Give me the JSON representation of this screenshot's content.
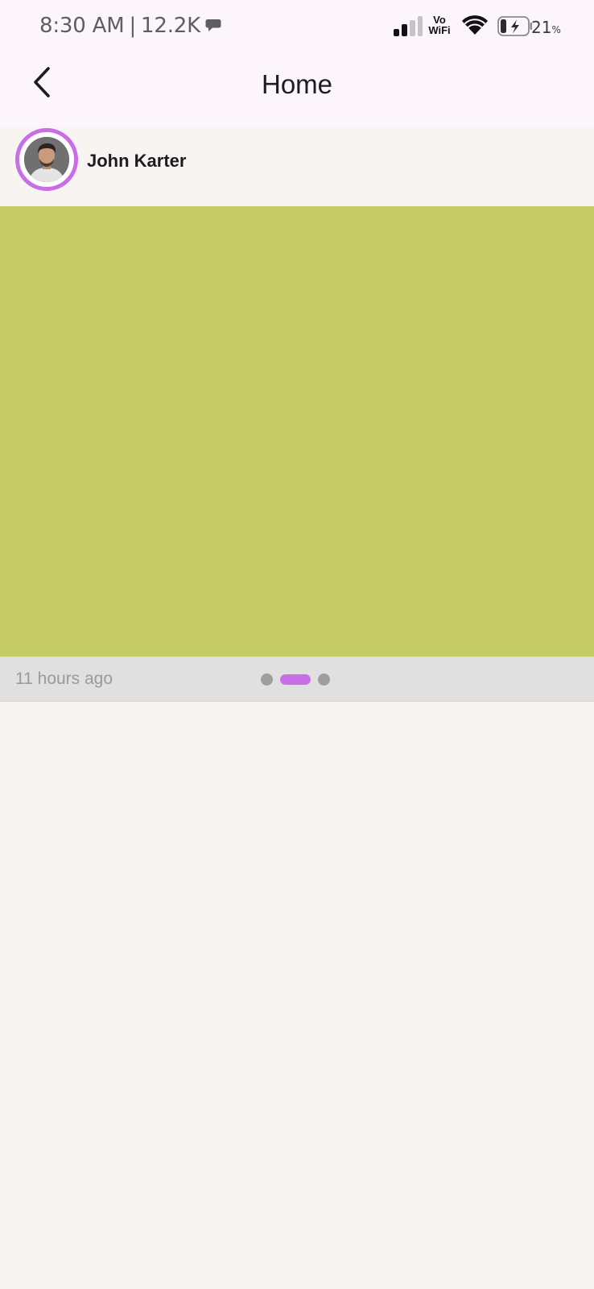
{
  "status_bar": {
    "time": "8:30 AM",
    "separator": "|",
    "network_speed": "12.2K",
    "vowifi_top": "Vo",
    "vowifi_bottom": "WiFi",
    "battery_level": "21",
    "battery_unit": "%",
    "icons": [
      "chat-bubble-icon",
      "signal-icon",
      "vowifi-icon",
      "wifi-icon",
      "battery-charging-icon"
    ]
  },
  "app_bar": {
    "title": "Home",
    "back_icon": "chevron-left-icon"
  },
  "post": {
    "author_name": "John Karter",
    "media_color": "#c5cb65",
    "timestamp": "11 hours ago",
    "page_indicator": {
      "count": 3,
      "active_index": 1
    }
  },
  "colors": {
    "accent": "#c96ee6",
    "surface": "#fcf6fc",
    "background": "#f8f4f2",
    "footer": "#e0e0e0"
  }
}
